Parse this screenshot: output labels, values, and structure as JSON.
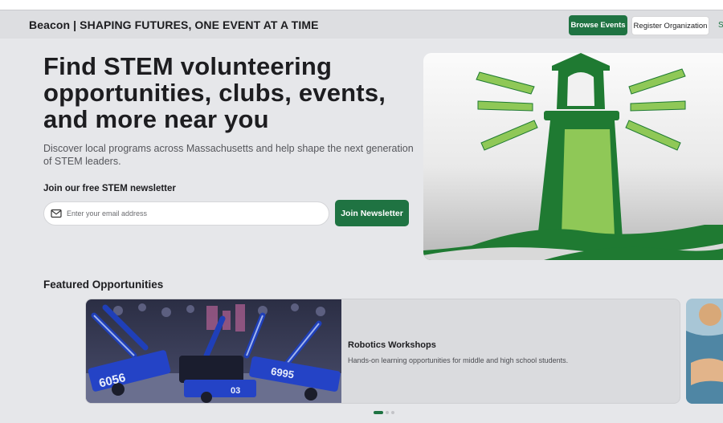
{
  "header": {
    "brand": "Beacon | SHAPING FUTURES, ONE EVENT AT A TIME",
    "browse_label": "Browse Events",
    "register_label": "Register Organization",
    "overflow_label": "S"
  },
  "hero": {
    "title": "Find STEM volunteering opportunities, clubs, events, and more near you",
    "subtitle": "Discover local programs across Massachusetts and help shape the next generation of STEM leaders.",
    "newsletter_label": "Join our free STEM newsletter",
    "email_placeholder": "Enter your email address",
    "join_label": "Join Newsletter",
    "image_icon": "lighthouse-logo-icon"
  },
  "featured": {
    "heading": "Featured Opportunities",
    "cards": [
      {
        "title": "Robotics Workshops",
        "description": "Hands-on learning opportunities for middle and high school students.",
        "image_icon": "robotics-photo",
        "robot_numbers": [
          "6056",
          "6995",
          "03"
        ]
      }
    ],
    "carousel_pages": 3,
    "active_page": 1
  },
  "colors": {
    "accent": "#1f7342",
    "background": "#e6e7ea",
    "lighthouse_dark": "#1f7a32",
    "lighthouse_light": "#8fc857"
  }
}
